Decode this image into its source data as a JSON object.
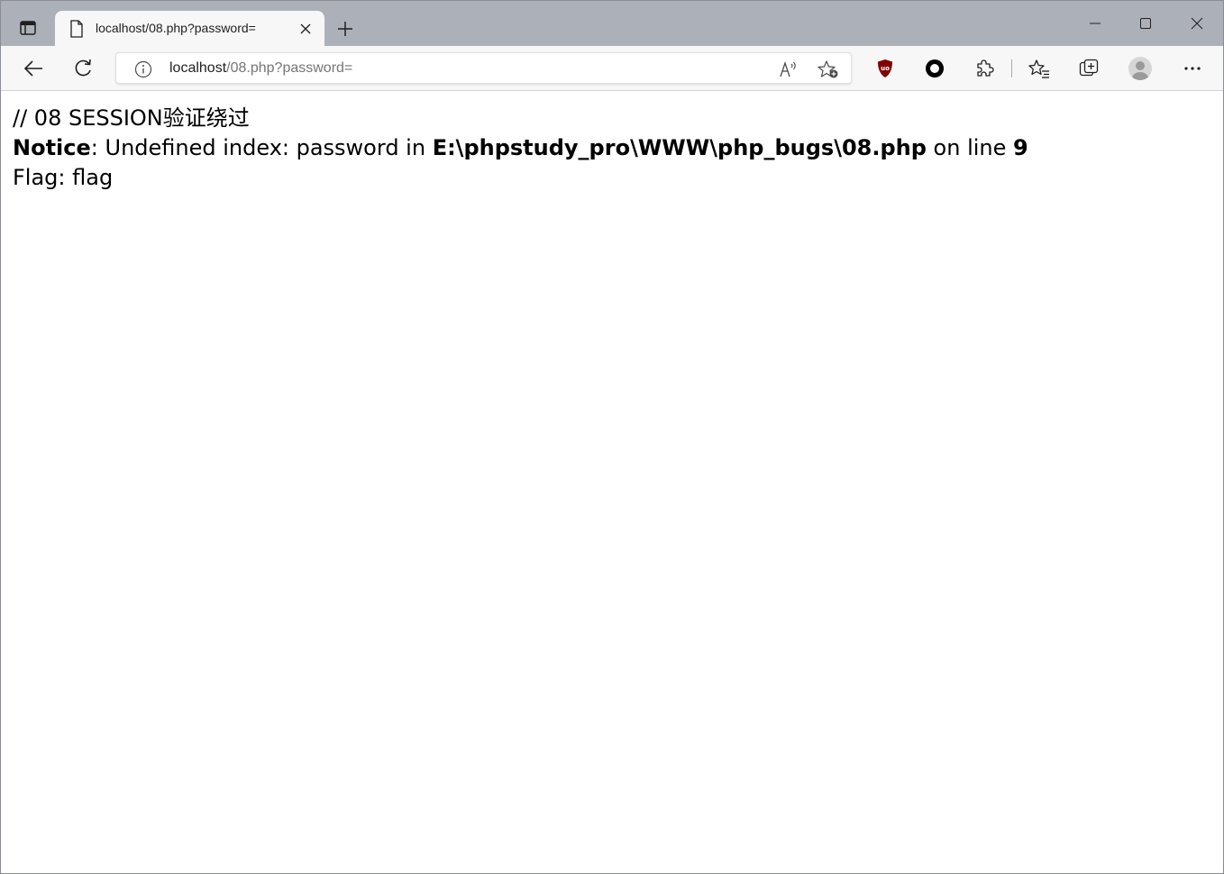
{
  "browser": {
    "tab": {
      "title": "localhost/08.php?password="
    },
    "address_bar": {
      "url_host": "localhost",
      "url_path": "/08.php?password="
    },
    "toolbar_icons": [
      "back-arrow-icon",
      "refresh-icon",
      "site-info-icon",
      "read-aloud-icon",
      "add-favorite-icon",
      "ublock-origin-icon",
      "record-circle-icon",
      "extensions-icon",
      "favorites-icon",
      "collections-icon",
      "profile-avatar-icon",
      "more-menu-icon"
    ],
    "colors": {
      "titlebar_bg": "#acb0b8",
      "toolbar_bg": "#f7f7f7",
      "ublock_red": "#800000"
    }
  },
  "page": {
    "comment_line": "// 08 SESSION验证绕过",
    "notice": {
      "label": "Notice",
      "message": ": Undefined index: password in ",
      "file_path": "E:\\phpstudy_pro\\WWW\\php_bugs\\08.php",
      "line_text": " on line ",
      "line_number": "9"
    },
    "flag_line": "Flag: flag"
  }
}
